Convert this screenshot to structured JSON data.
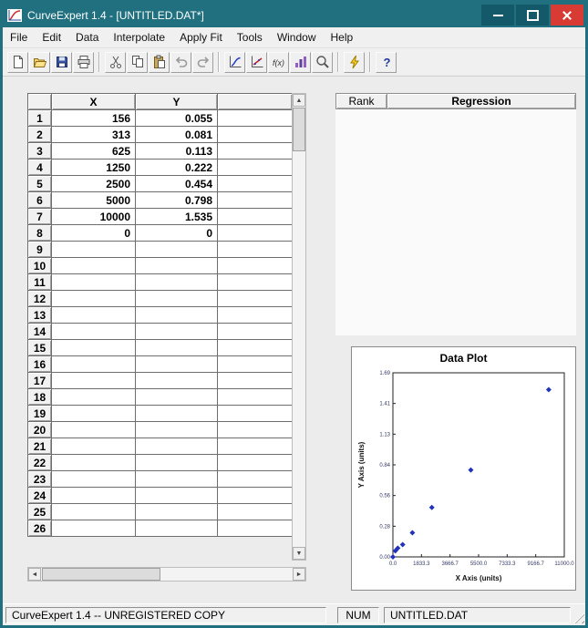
{
  "window": {
    "title": "CurveExpert 1.4 - [UNTITLED.DAT*]"
  },
  "menu": {
    "items": [
      "File",
      "Edit",
      "Data",
      "Interpolate",
      "Apply Fit",
      "Tools",
      "Window",
      "Help"
    ]
  },
  "toolbar": {
    "buttons": [
      {
        "name": "new"
      },
      {
        "name": "open"
      },
      {
        "name": "save"
      },
      {
        "name": "print",
        "sep_after": true
      },
      {
        "name": "cut"
      },
      {
        "name": "copy"
      },
      {
        "name": "paste"
      },
      {
        "name": "undo",
        "disabled": true
      },
      {
        "name": "redo",
        "disabled": true,
        "sep_after": true
      },
      {
        "name": "plot-data"
      },
      {
        "name": "curve-fit"
      },
      {
        "name": "evaluate"
      },
      {
        "name": "rank-fits"
      },
      {
        "name": "zoom",
        "sep_after": true
      },
      {
        "name": "calculate",
        "sep_after": true
      },
      {
        "name": "help"
      }
    ]
  },
  "grid": {
    "columns": [
      "X",
      "Y",
      ""
    ],
    "rows": [
      {
        "n": "1",
        "x": "156",
        "y": "0.055"
      },
      {
        "n": "2",
        "x": "313",
        "y": "0.081"
      },
      {
        "n": "3",
        "x": "625",
        "y": "0.113"
      },
      {
        "n": "4",
        "x": "1250",
        "y": "0.222"
      },
      {
        "n": "5",
        "x": "2500",
        "y": "0.454"
      },
      {
        "n": "6",
        "x": "5000",
        "y": "0.798"
      },
      {
        "n": "7",
        "x": "10000",
        "y": "1.535"
      },
      {
        "n": "8",
        "x": "0",
        "y": "0"
      },
      {
        "n": "9",
        "x": "",
        "y": ""
      },
      {
        "n": "10",
        "x": "",
        "y": ""
      },
      {
        "n": "11",
        "x": "",
        "y": ""
      },
      {
        "n": "12",
        "x": "",
        "y": ""
      },
      {
        "n": "13",
        "x": "",
        "y": ""
      },
      {
        "n": "14",
        "x": "",
        "y": ""
      },
      {
        "n": "15",
        "x": "",
        "y": ""
      },
      {
        "n": "16",
        "x": "",
        "y": ""
      },
      {
        "n": "17",
        "x": "",
        "y": ""
      },
      {
        "n": "18",
        "x": "",
        "y": ""
      },
      {
        "n": "19",
        "x": "",
        "y": ""
      },
      {
        "n": "20",
        "x": "",
        "y": ""
      },
      {
        "n": "21",
        "x": "",
        "y": ""
      },
      {
        "n": "22",
        "x": "",
        "y": ""
      },
      {
        "n": "23",
        "x": "",
        "y": ""
      },
      {
        "n": "24",
        "x": "",
        "y": ""
      },
      {
        "n": "25",
        "x": "",
        "y": ""
      },
      {
        "n": "26",
        "x": "",
        "y": ""
      }
    ]
  },
  "scrollbars": {
    "up": "▲",
    "down": "▼",
    "left": "◄",
    "right": "►"
  },
  "rank_panel": {
    "rank_label": "Rank",
    "regression_label": "Regression"
  },
  "plot": {
    "title": "Data Plot"
  },
  "chart_data": {
    "type": "scatter",
    "title": "Data Plot",
    "xlabel": "X Axis (units)",
    "ylabel": "Y Axis (units)",
    "x": [
      156,
      313,
      625,
      1250,
      2500,
      5000,
      10000,
      0
    ],
    "y": [
      0.055,
      0.081,
      0.113,
      0.222,
      0.454,
      0.798,
      1.535,
      0
    ],
    "xlim": [
      0,
      11000
    ],
    "ylim": [
      0,
      1.69
    ],
    "x_ticks": [
      "0.0",
      "1833.3",
      "3666.7",
      "5500.0",
      "7333.3",
      "9166.7",
      "11000.0"
    ],
    "y_ticks": [
      "1.69",
      "1.41",
      "1.13",
      "0.84",
      "0.56",
      "0.28",
      "0.00"
    ],
    "marker": "diamond",
    "marker_color": "#2233bb",
    "grid": false,
    "legend": false
  },
  "statusbar": {
    "message": "CurveExpert 1.4 -- UNREGISTERED COPY",
    "num": "NUM",
    "file": "UNTITLED.DAT"
  }
}
